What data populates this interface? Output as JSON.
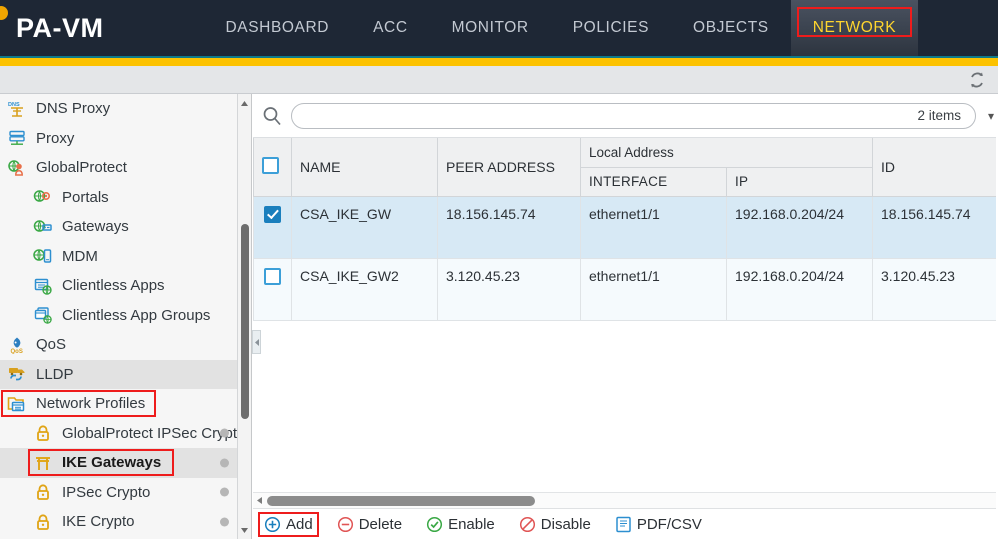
{
  "topnav": {
    "brand": "PA-VM",
    "tabs": [
      {
        "label": "DASHBOARD",
        "active": false
      },
      {
        "label": "ACC",
        "active": false
      },
      {
        "label": "MONITOR",
        "active": false
      },
      {
        "label": "POLICIES",
        "active": false
      },
      {
        "label": "OBJECTS",
        "active": false
      },
      {
        "label": "NETWORK",
        "active": true
      }
    ],
    "active_tab_color": "#ffd52e",
    "annotation_color": "#ee1c1c",
    "accent_bar_color": "#fcc200"
  },
  "toolstrip": {
    "refresh_icon": "refresh-icon"
  },
  "sidebar": {
    "items": [
      {
        "label": "DNS Proxy",
        "icon": "dns-proxy-icon",
        "indent": false,
        "selected": false,
        "highlight": false,
        "dot": false,
        "annotated": false
      },
      {
        "label": "Proxy",
        "icon": "proxy-icon",
        "indent": false,
        "selected": false,
        "highlight": false,
        "dot": false,
        "annotated": false
      },
      {
        "label": "GlobalProtect",
        "icon": "globalprotect-icon",
        "indent": false,
        "selected": false,
        "highlight": false,
        "dot": false,
        "annotated": false
      },
      {
        "label": "Portals",
        "icon": "portals-icon",
        "indent": true,
        "selected": false,
        "highlight": false,
        "dot": false,
        "annotated": false
      },
      {
        "label": "Gateways",
        "icon": "gateways-icon",
        "indent": true,
        "selected": false,
        "highlight": false,
        "dot": false,
        "annotated": false
      },
      {
        "label": "MDM",
        "icon": "mdm-icon",
        "indent": true,
        "selected": false,
        "highlight": false,
        "dot": false,
        "annotated": false
      },
      {
        "label": "Clientless Apps",
        "icon": "clientless-apps-icon",
        "indent": true,
        "selected": false,
        "highlight": false,
        "dot": false,
        "annotated": false
      },
      {
        "label": "Clientless App Groups",
        "icon": "clientless-app-groups-icon",
        "indent": true,
        "selected": false,
        "highlight": false,
        "dot": false,
        "annotated": false
      },
      {
        "label": "QoS",
        "icon": "qos-icon",
        "indent": false,
        "selected": false,
        "highlight": false,
        "dot": false,
        "annotated": false
      },
      {
        "label": "LLDP",
        "icon": "lldp-icon",
        "indent": false,
        "selected": false,
        "highlight": true,
        "dot": false,
        "annotated": false
      },
      {
        "label": "Network Profiles",
        "icon": "network-profiles-icon",
        "indent": false,
        "selected": false,
        "highlight": false,
        "dot": false,
        "annotated": true
      },
      {
        "label": "GlobalProtect IPSec Crypto",
        "icon": "lock-icon",
        "indent": true,
        "selected": false,
        "highlight": false,
        "dot": true,
        "annotated": false
      },
      {
        "label": "IKE Gateways",
        "icon": "ike-gateway-icon",
        "indent": true,
        "selected": true,
        "highlight": false,
        "dot": true,
        "annotated": true
      },
      {
        "label": "IPSec Crypto",
        "icon": "lock-icon",
        "indent": true,
        "selected": false,
        "highlight": false,
        "dot": true,
        "annotated": false
      },
      {
        "label": "IKE Crypto",
        "icon": "lock-icon",
        "indent": true,
        "selected": false,
        "highlight": false,
        "dot": true,
        "annotated": false
      }
    ],
    "scroll_up_icon": "scroll-up-arrow-icon",
    "scroll_down_icon": "scroll-down-arrow-icon"
  },
  "search": {
    "value": "",
    "placeholder": "",
    "icon": "search-icon",
    "items_count": "2 items"
  },
  "table": {
    "group_headers": [
      {
        "label": "",
        "span": 1
      },
      {
        "label": "",
        "span": 1
      },
      {
        "label": "",
        "span": 1
      },
      {
        "label": "Local Address",
        "span": 2
      },
      {
        "label": "",
        "span": 1
      },
      {
        "label": "",
        "span": 1
      }
    ],
    "columns": [
      "",
      "NAME",
      "PEER ADDRESS",
      "INTERFACE",
      "IP",
      "ID",
      ""
    ],
    "header_checkbox_checked": false,
    "rows": [
      {
        "checked": true,
        "name": "CSA_IKE_GW",
        "peer_address": "18.156.145.74",
        "interface": "ethernet1/1",
        "ip": "192.168.0.204/24",
        "id": "18.156.145.74"
      },
      {
        "checked": false,
        "name": "CSA_IKE_GW2",
        "peer_address": "3.120.45.23",
        "interface": "ethernet1/1",
        "ip": "192.168.0.204/24",
        "id": "3.120.45.23"
      }
    ]
  },
  "actions": [
    {
      "label": "Add",
      "icon": "plus-circle-icon",
      "color": "#1a7fbd",
      "annotated": true
    },
    {
      "label": "Delete",
      "icon": "minus-circle-icon",
      "color": "#e05555",
      "annotated": false
    },
    {
      "label": "Enable",
      "icon": "check-circle-icon",
      "color": "#3aa845",
      "annotated": false
    },
    {
      "label": "Disable",
      "icon": "no-entry-circle-icon",
      "color": "#e05555",
      "annotated": false
    },
    {
      "label": "PDF/CSV",
      "icon": "pdf-csv-icon",
      "color": "#2d8fd0",
      "annotated": false
    }
  ],
  "scrollbars": {
    "horizontal_left_arrow_icon": "scroll-left-arrow-icon",
    "splitter_collapse_icon": "collapse-left-arrow-icon"
  }
}
